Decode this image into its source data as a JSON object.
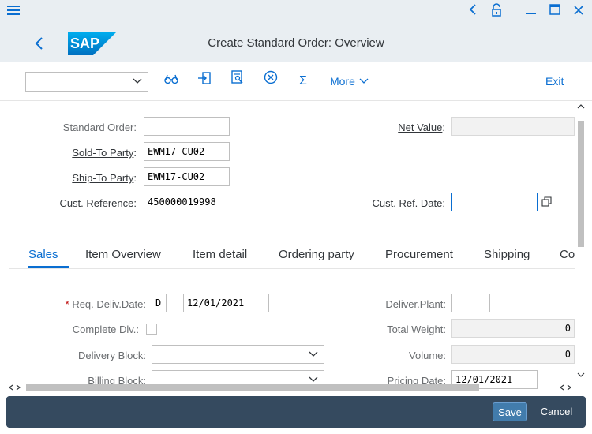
{
  "window": {
    "menu_icon": "hamburger-icon",
    "buttons": [
      "back-arrow-icon",
      "unlock-icon",
      "minimize-icon",
      "maximize-icon",
      "close-icon"
    ]
  },
  "header": {
    "title": "Create Standard Order: Overview",
    "logo_text": "SAP",
    "brand_color": "#0a6ed1"
  },
  "toolbar": {
    "dropdown_value": "",
    "icons": [
      "glasses-icon",
      "import-icon",
      "document-search-icon",
      "cancel-circle-icon",
      "sum-icon"
    ],
    "more_label": "More",
    "exit_label": "Exit"
  },
  "header_fields": {
    "standard_order": {
      "label": "Standard Order:",
      "value": ""
    },
    "sold_to": {
      "label": "Sold-To Party",
      "value": "EWM17-CU02"
    },
    "ship_to": {
      "label": "Ship-To Party",
      "value": "EWM17-CU02"
    },
    "cust_ref": {
      "label": "Cust. Reference",
      "value": "450000019998"
    },
    "net_value": {
      "label": "Net Value",
      "value": ""
    },
    "cust_ref_date": {
      "label": "Cust. Ref. Date",
      "value": ""
    },
    "colon": ":"
  },
  "tabs": [
    {
      "label": "Sales"
    },
    {
      "label": "Item Overview"
    },
    {
      "label": "Item detail"
    },
    {
      "label": "Ordering party"
    },
    {
      "label": "Procurement"
    },
    {
      "label": "Shipping"
    },
    {
      "label": "Co"
    }
  ],
  "sales_tab": {
    "req_deliv_date": {
      "required_mark": "*",
      "label": "Req. Deliv.Date:",
      "unit": "D",
      "value": "12/01/2021"
    },
    "complete_dlv": {
      "label": "Complete Dlv.:",
      "checked": false
    },
    "delivery_block": {
      "label": "Delivery Block:",
      "value": ""
    },
    "billing_block": {
      "label": "Billing Block:",
      "value": ""
    },
    "deliver_plant": {
      "label": "Deliver.Plant:",
      "value": ""
    },
    "total_weight": {
      "label": "Total Weight:",
      "value": "0"
    },
    "volume": {
      "label": "Volume:",
      "value": "0"
    },
    "pricing_date": {
      "label": "Pricing Date:",
      "value": "12/01/2021"
    }
  },
  "footer": {
    "save_label": "Save",
    "cancel_label": "Cancel"
  }
}
